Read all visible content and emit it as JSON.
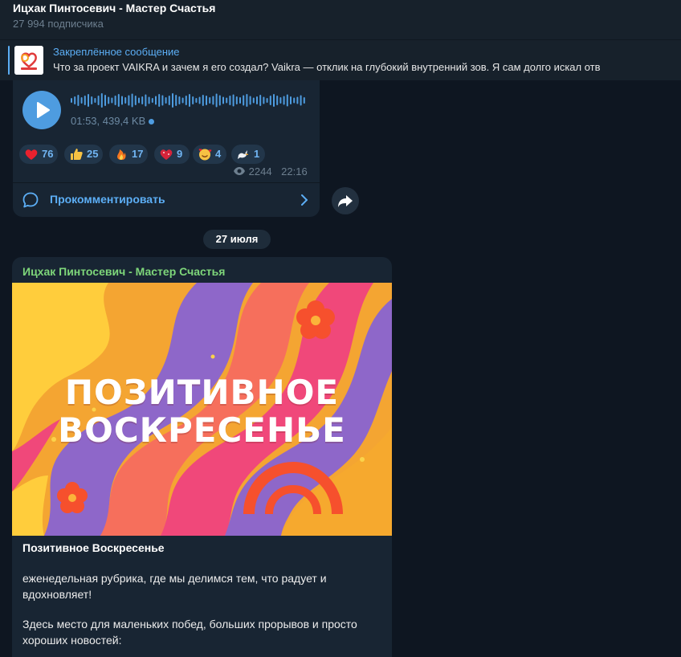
{
  "header": {
    "channel_name": "Ицхак Пинтосевич - Мастер Счастья",
    "subscribers": "27 994 подписчика"
  },
  "pinned": {
    "title": "Закреплённое сообщение",
    "text": "Что за проект VAIKRA и зачем я его создал?  Vaikra — отклик на глубокий внутренний зов.  Я сам долго искал отв",
    "thumb_icon": "vaikra-logo-icon"
  },
  "voice_message": {
    "meta": "01:53, 439,4 KB",
    "play_icon": "play-icon"
  },
  "reactions": [
    {
      "emoji": "red-heart",
      "count": "76"
    },
    {
      "emoji": "thumbs-up",
      "count": "25"
    },
    {
      "emoji": "fire",
      "count": "17"
    },
    {
      "emoji": "heart-with-sparkles",
      "count": "9"
    },
    {
      "emoji": "smiling-face-with-hearts",
      "count": "4"
    },
    {
      "emoji": "dove",
      "count": "1"
    }
  ],
  "post1_footer": {
    "views": "2244",
    "time": "22:16",
    "comment_label": "Прокомментировать"
  },
  "date_separator": "27 июля",
  "post2": {
    "author": "Ицхак Пинтосевич - Мастер Счастья",
    "image_text_line1": "ПОЗИТИВНОЕ",
    "image_text_line2": "ВОСКРЕСЕНЬЕ",
    "title": "Позитивное Воскресенье",
    "paragraph1": "еженедельная рубрика, где мы делимся тем, что радует и вдохновляет!",
    "paragraph2": "Здесь место для маленьких побед, больших прорывов и просто хороших новостей:"
  },
  "colors": {
    "background": "#0e1621",
    "bubble": "#182533",
    "accent": "#5caef5",
    "author_green": "#7ed67a"
  }
}
